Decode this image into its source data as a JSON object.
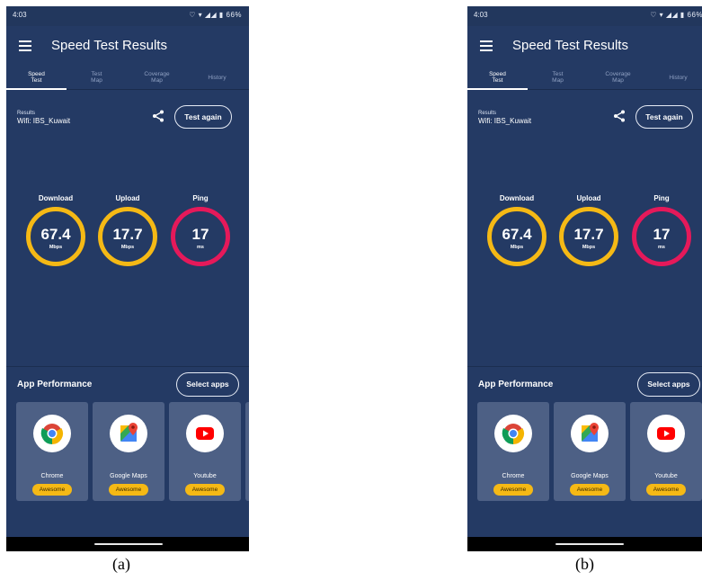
{
  "status": {
    "time": "4:03",
    "icons": "♡ ▾ ◢◢ ▮ 66%"
  },
  "app_title": "Speed Test Results",
  "tabs": [
    {
      "label": "Speed\nTest"
    },
    {
      "label": "Test\nMap"
    },
    {
      "label": "Coverage\nMap"
    },
    {
      "label": "History"
    }
  ],
  "results": {
    "label": "Results",
    "network": "Wifi: IBS_Kuwait",
    "test_again": "Test again"
  },
  "metrics": {
    "download": {
      "label": "Download",
      "value": "67.4",
      "unit": "Mbps"
    },
    "upload": {
      "label": "Upload",
      "value": "17.7",
      "unit": "Mbps"
    },
    "ping": {
      "label": "Ping",
      "value": "17",
      "unit": "ms"
    }
  },
  "app_performance": {
    "title": "App Performance",
    "select_apps": "Select apps",
    "apps": [
      {
        "name": "Chrome",
        "rating": "Awesome",
        "icon": "chrome-icon"
      },
      {
        "name": "Google Maps",
        "rating": "Awesome",
        "icon": "google-maps-icon"
      },
      {
        "name": "Youtube",
        "rating": "Awesome",
        "icon": "youtube-icon"
      }
    ]
  },
  "captions": {
    "a": "(a)",
    "b": "(b)"
  },
  "colors": {
    "background": "#243a64",
    "ring_yellow": "#f5b915",
    "ring_pink": "#e5195a",
    "card": "#4d6085"
  }
}
